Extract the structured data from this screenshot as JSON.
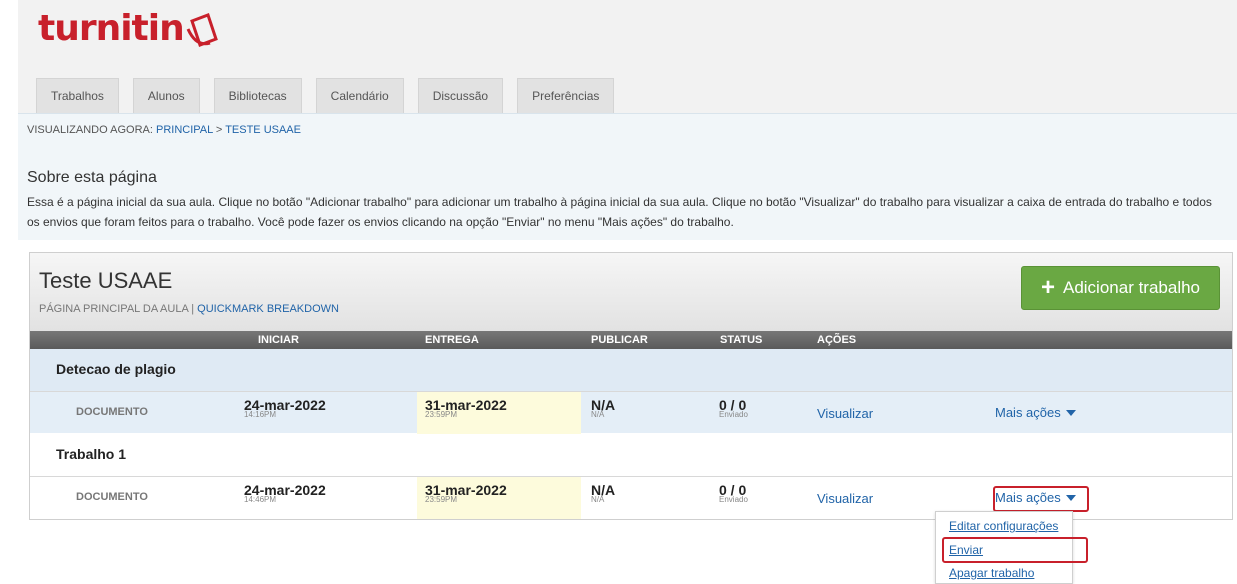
{
  "brand": {
    "logo_text": "turnitin",
    "color": "#c8202b"
  },
  "tabs": [
    "Trabalhos",
    "Alunos",
    "Bibliotecas",
    "Calendário",
    "Discussão",
    "Preferências"
  ],
  "breadcrumb": {
    "prefix": "VISUALIZANDO AGORA: ",
    "home": "PRINCIPAL",
    "sep": " > ",
    "current": "TESTE USAAE"
  },
  "about": {
    "title": "Sobre esta página",
    "text": "Essa é a página inicial da sua aula. Clique no botão \"Adicionar trabalho\" para adicionar um trabalho à página inicial da sua aula. Clique no botão \"Visualizar\" do trabalho para visualizar a caixa de entrada do trabalho e todos os envios que foram feitos para o trabalho. Você pode fazer os envios clicando na opção \"Enviar\" no menu \"Mais ações\" do trabalho."
  },
  "class": {
    "title": "Teste USAAE",
    "sub_prefix": "PÁGINA PRINCIPAL DA AULA | ",
    "sub_link": "QUICKMARK BREAKDOWN",
    "add_button": "Adicionar trabalho",
    "add_button_color": "#6aa843"
  },
  "columns": {
    "start": "INICIAR",
    "due": "ENTREGA",
    "post": "PUBLICAR",
    "status": "STATUS",
    "actions": "AÇÕES"
  },
  "assignments": [
    {
      "title": "Detecao de plagio",
      "type": "DOCUMENTO",
      "start_date": "24-mar-2022",
      "start_time": "14:16PM",
      "due_date": "31-mar-2022",
      "due_time": "23:59PM",
      "post": "N/A",
      "post_sub": "N/A",
      "status": "0 / 0",
      "status_sub": "Enviado",
      "view": "Visualizar",
      "more": "Mais ações"
    },
    {
      "title": "Trabalho 1",
      "type": "DOCUMENTO",
      "start_date": "24-mar-2022",
      "start_time": "14:46PM",
      "due_date": "31-mar-2022",
      "due_time": "23:59PM",
      "post": "N/A",
      "post_sub": "N/A",
      "status": "0 / 0",
      "status_sub": "Enviado",
      "view": "Visualizar",
      "more": "Mais ações"
    }
  ],
  "dropdown": [
    "Editar configurações",
    "Enviar",
    "Apagar trabalho"
  ]
}
